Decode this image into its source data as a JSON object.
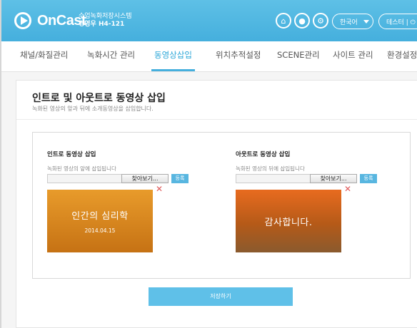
{
  "header": {
    "logo_text": "OnCast",
    "system_name": "수업녹화저장시스템",
    "room_label": "경영우 H4-121",
    "language": "한국어",
    "user_pill": "테스터 | ⏻"
  },
  "nav": {
    "items": [
      "채널/화질관리",
      "녹화시간 관리",
      "동영상삽입",
      "위치추적설정",
      "SCENE관리",
      "사이트 관리",
      "환경설정"
    ],
    "active_index": 2
  },
  "page": {
    "title": "인트로 및 아웃트로 동영상 삽입",
    "subtitle": "녹화된 영상의 앞과 뒤에 소개동영상을 삽입합니다."
  },
  "intro": {
    "title": "인트로 동영상 삽입",
    "description": "녹화된 영상의 앞에 삽입됩니다",
    "browse_label": "찾아보기...",
    "register_label": "등록",
    "thumb_text": "인간의 심리학",
    "thumb_date": "2014.04.15"
  },
  "outro": {
    "title": "아웃트로 동영상 삽입",
    "description": "녹화된 영상의 뒤에 삽입됩니다",
    "browse_label": "찾아보기...",
    "register_label": "등록",
    "thumb_text": "감사합니다."
  },
  "save_label": "저장하기",
  "colors": {
    "header": "#45afdd",
    "accent": "#5fc0e8",
    "delete": "#e05a5a"
  }
}
